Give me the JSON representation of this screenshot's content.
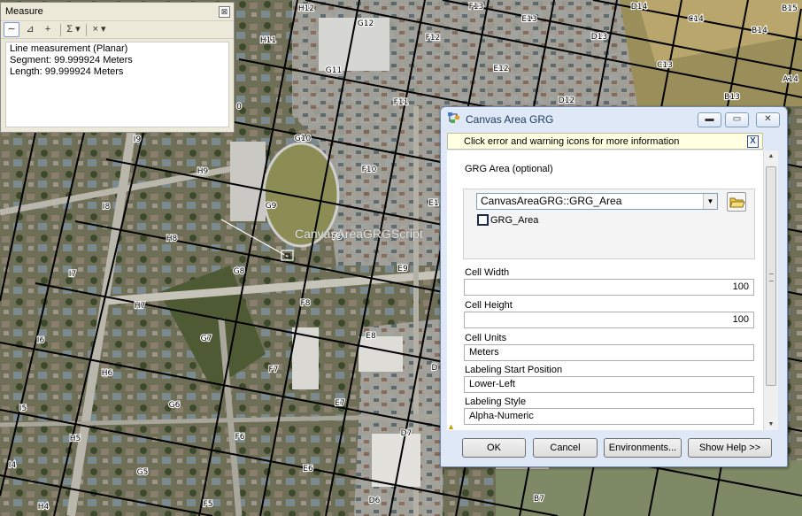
{
  "measure": {
    "title": "Measure",
    "close_glyph": "⊠",
    "tools": [
      {
        "icon": "measure-line-icon",
        "glyph": "∼",
        "active": true
      },
      {
        "icon": "measure-area-icon",
        "glyph": "⊿",
        "active": false
      },
      {
        "icon": "measure-feature-icon",
        "glyph": "+",
        "active": false
      },
      {
        "icon": "sum-icon",
        "glyph": "Σ ▾",
        "active": false
      },
      {
        "icon": "clear-icon",
        "glyph": "× ▾",
        "active": false
      }
    ],
    "results": [
      "Line measurement (Planar)",
      "Segment: 99.999924 Meters",
      "Length: 99.999924 Meters"
    ]
  },
  "map": {
    "overlay_text": "CanvasAreaGRGScript",
    "grid_labels": [
      [
        "H12",
        346,
        12
      ],
      [
        "F13",
        538,
        10
      ],
      [
        "E13",
        598,
        24
      ],
      [
        "D14",
        722,
        10
      ],
      [
        "C14",
        786,
        24
      ],
      [
        "B15",
        892,
        12
      ],
      [
        "G12",
        413,
        29
      ],
      [
        "H11",
        303,
        48
      ],
      [
        "F12",
        489,
        45
      ],
      [
        "D13",
        677,
        44
      ],
      [
        "B14",
        858,
        37
      ],
      [
        "C13",
        751,
        76
      ],
      [
        "G11",
        377,
        82
      ],
      [
        "E12",
        566,
        80
      ],
      [
        "A14",
        893,
        92
      ],
      [
        "D12",
        640,
        116
      ],
      [
        "B13",
        827,
        112
      ],
      [
        "0",
        270,
        123
      ],
      [
        "F11",
        453,
        118
      ],
      [
        "H9",
        229,
        196
      ],
      [
        "I9",
        155,
        160
      ],
      [
        "G10",
        342,
        159
      ],
      [
        "F10",
        417,
        194
      ],
      [
        "E1",
        490,
        232
      ],
      [
        "I8",
        120,
        236
      ],
      [
        "G9",
        306,
        235
      ],
      [
        "H8",
        194,
        272
      ],
      [
        "F9",
        381,
        270
      ],
      [
        "I7",
        82,
        312
      ],
      [
        "G8",
        270,
        309
      ],
      [
        "E9",
        455,
        306
      ],
      [
        "H7",
        158,
        348
      ],
      [
        "F8",
        345,
        345
      ],
      [
        "I6",
        46,
        387
      ],
      [
        "G7",
        233,
        385
      ],
      [
        "E8",
        419,
        382
      ],
      [
        "H6",
        121,
        424
      ],
      [
        "F7",
        309,
        420
      ],
      [
        "D",
        491,
        418
      ],
      [
        "I5",
        26,
        464
      ],
      [
        "G6",
        197,
        460
      ],
      [
        "E7",
        384,
        458
      ],
      [
        "H5",
        85,
        498
      ],
      [
        "F6",
        271,
        496
      ],
      [
        "D7",
        459,
        492
      ],
      [
        "I4",
        14,
        528
      ],
      [
        "G5",
        161,
        536
      ],
      [
        "E6",
        348,
        532
      ],
      [
        "H4",
        49,
        575
      ],
      [
        "F5",
        235,
        572
      ],
      [
        "D6",
        423,
        568
      ],
      [
        "B7",
        609,
        566
      ]
    ]
  },
  "dialog": {
    "title": "Canvas Area GRG",
    "info_message": "Click error and warning icons for more information",
    "info_close_glyph": "X",
    "grg_area_label": "GRG Area (optional)",
    "grg_area_value": "CanvasAreaGRG::GRG_Area",
    "grg_area_layer": "GRG_Area",
    "cell_width_label": "Cell Width",
    "cell_width_value": "100",
    "cell_height_label": "Cell Height",
    "cell_height_value": "100",
    "cell_units_label": "Cell Units",
    "cell_units_value": "Meters",
    "start_position_label": "Labeling Start Position",
    "start_position_value": "Lower-Left",
    "labeling_style_label": "Labeling Style",
    "labeling_style_value": "Alpha-Numeric",
    "buttons": {
      "ok": "OK",
      "cancel": "Cancel",
      "environments": "Environments...",
      "help": "Show Help >>"
    }
  }
}
